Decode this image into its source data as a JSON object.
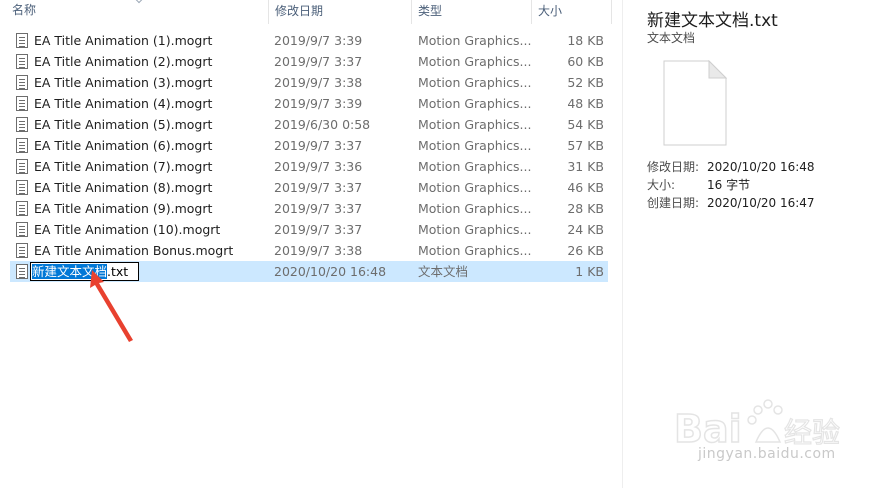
{
  "columns": {
    "name": "名称",
    "date": "修改日期",
    "type": "类型",
    "size": "大小"
  },
  "files": [
    {
      "name": "EA Title Animation (1).mogrt",
      "date": "2019/9/7 3:39",
      "type": "Motion Graphics...",
      "size": "18 KB"
    },
    {
      "name": "EA Title Animation (2).mogrt",
      "date": "2019/9/7 3:37",
      "type": "Motion Graphics...",
      "size": "60 KB"
    },
    {
      "name": "EA Title Animation (3).mogrt",
      "date": "2019/9/7 3:38",
      "type": "Motion Graphics...",
      "size": "52 KB"
    },
    {
      "name": "EA Title Animation (4).mogrt",
      "date": "2019/9/7 3:39",
      "type": "Motion Graphics...",
      "size": "48 KB"
    },
    {
      "name": "EA Title Animation (5).mogrt",
      "date": "2019/6/30 0:58",
      "type": "Motion Graphics...",
      "size": "54 KB"
    },
    {
      "name": "EA Title Animation (6).mogrt",
      "date": "2019/9/7 3:37",
      "type": "Motion Graphics...",
      "size": "57 KB"
    },
    {
      "name": "EA Title Animation (7).mogrt",
      "date": "2019/9/7 3:36",
      "type": "Motion Graphics...",
      "size": "31 KB"
    },
    {
      "name": "EA Title Animation (8).mogrt",
      "date": "2019/9/7 3:37",
      "type": "Motion Graphics...",
      "size": "46 KB"
    },
    {
      "name": "EA Title Animation (9).mogrt",
      "date": "2019/9/7 3:37",
      "type": "Motion Graphics...",
      "size": "28 KB"
    },
    {
      "name": "EA Title Animation (10).mogrt",
      "date": "2019/9/7 3:37",
      "type": "Motion Graphics...",
      "size": "24 KB"
    },
    {
      "name": "EA Title Animation Bonus.mogrt",
      "date": "2019/9/7 3:38",
      "type": "Motion Graphics...",
      "size": "26 KB"
    }
  ],
  "selected_file": {
    "name_selected_part": "新建文本文档",
    "name_extension": ".txt",
    "date": "2020/10/20 16:48",
    "type": "文本文档",
    "size": "1 KB"
  },
  "details": {
    "title": "新建文本文档.txt",
    "subtitle": "文本文档",
    "props": [
      {
        "label": "修改日期:",
        "value": "2020/10/20 16:48"
      },
      {
        "label": "大小:",
        "value": "16 字节"
      },
      {
        "label": "创建日期:",
        "value": "2020/10/20 16:47"
      }
    ]
  },
  "watermark": {
    "logo_text": "Bai 经验",
    "url": "jingyan.baidu.com"
  },
  "colors": {
    "selection_bg": "#cce8ff",
    "rename_highlight": "#0078d7",
    "annotation_arrow": "#e8412f"
  }
}
